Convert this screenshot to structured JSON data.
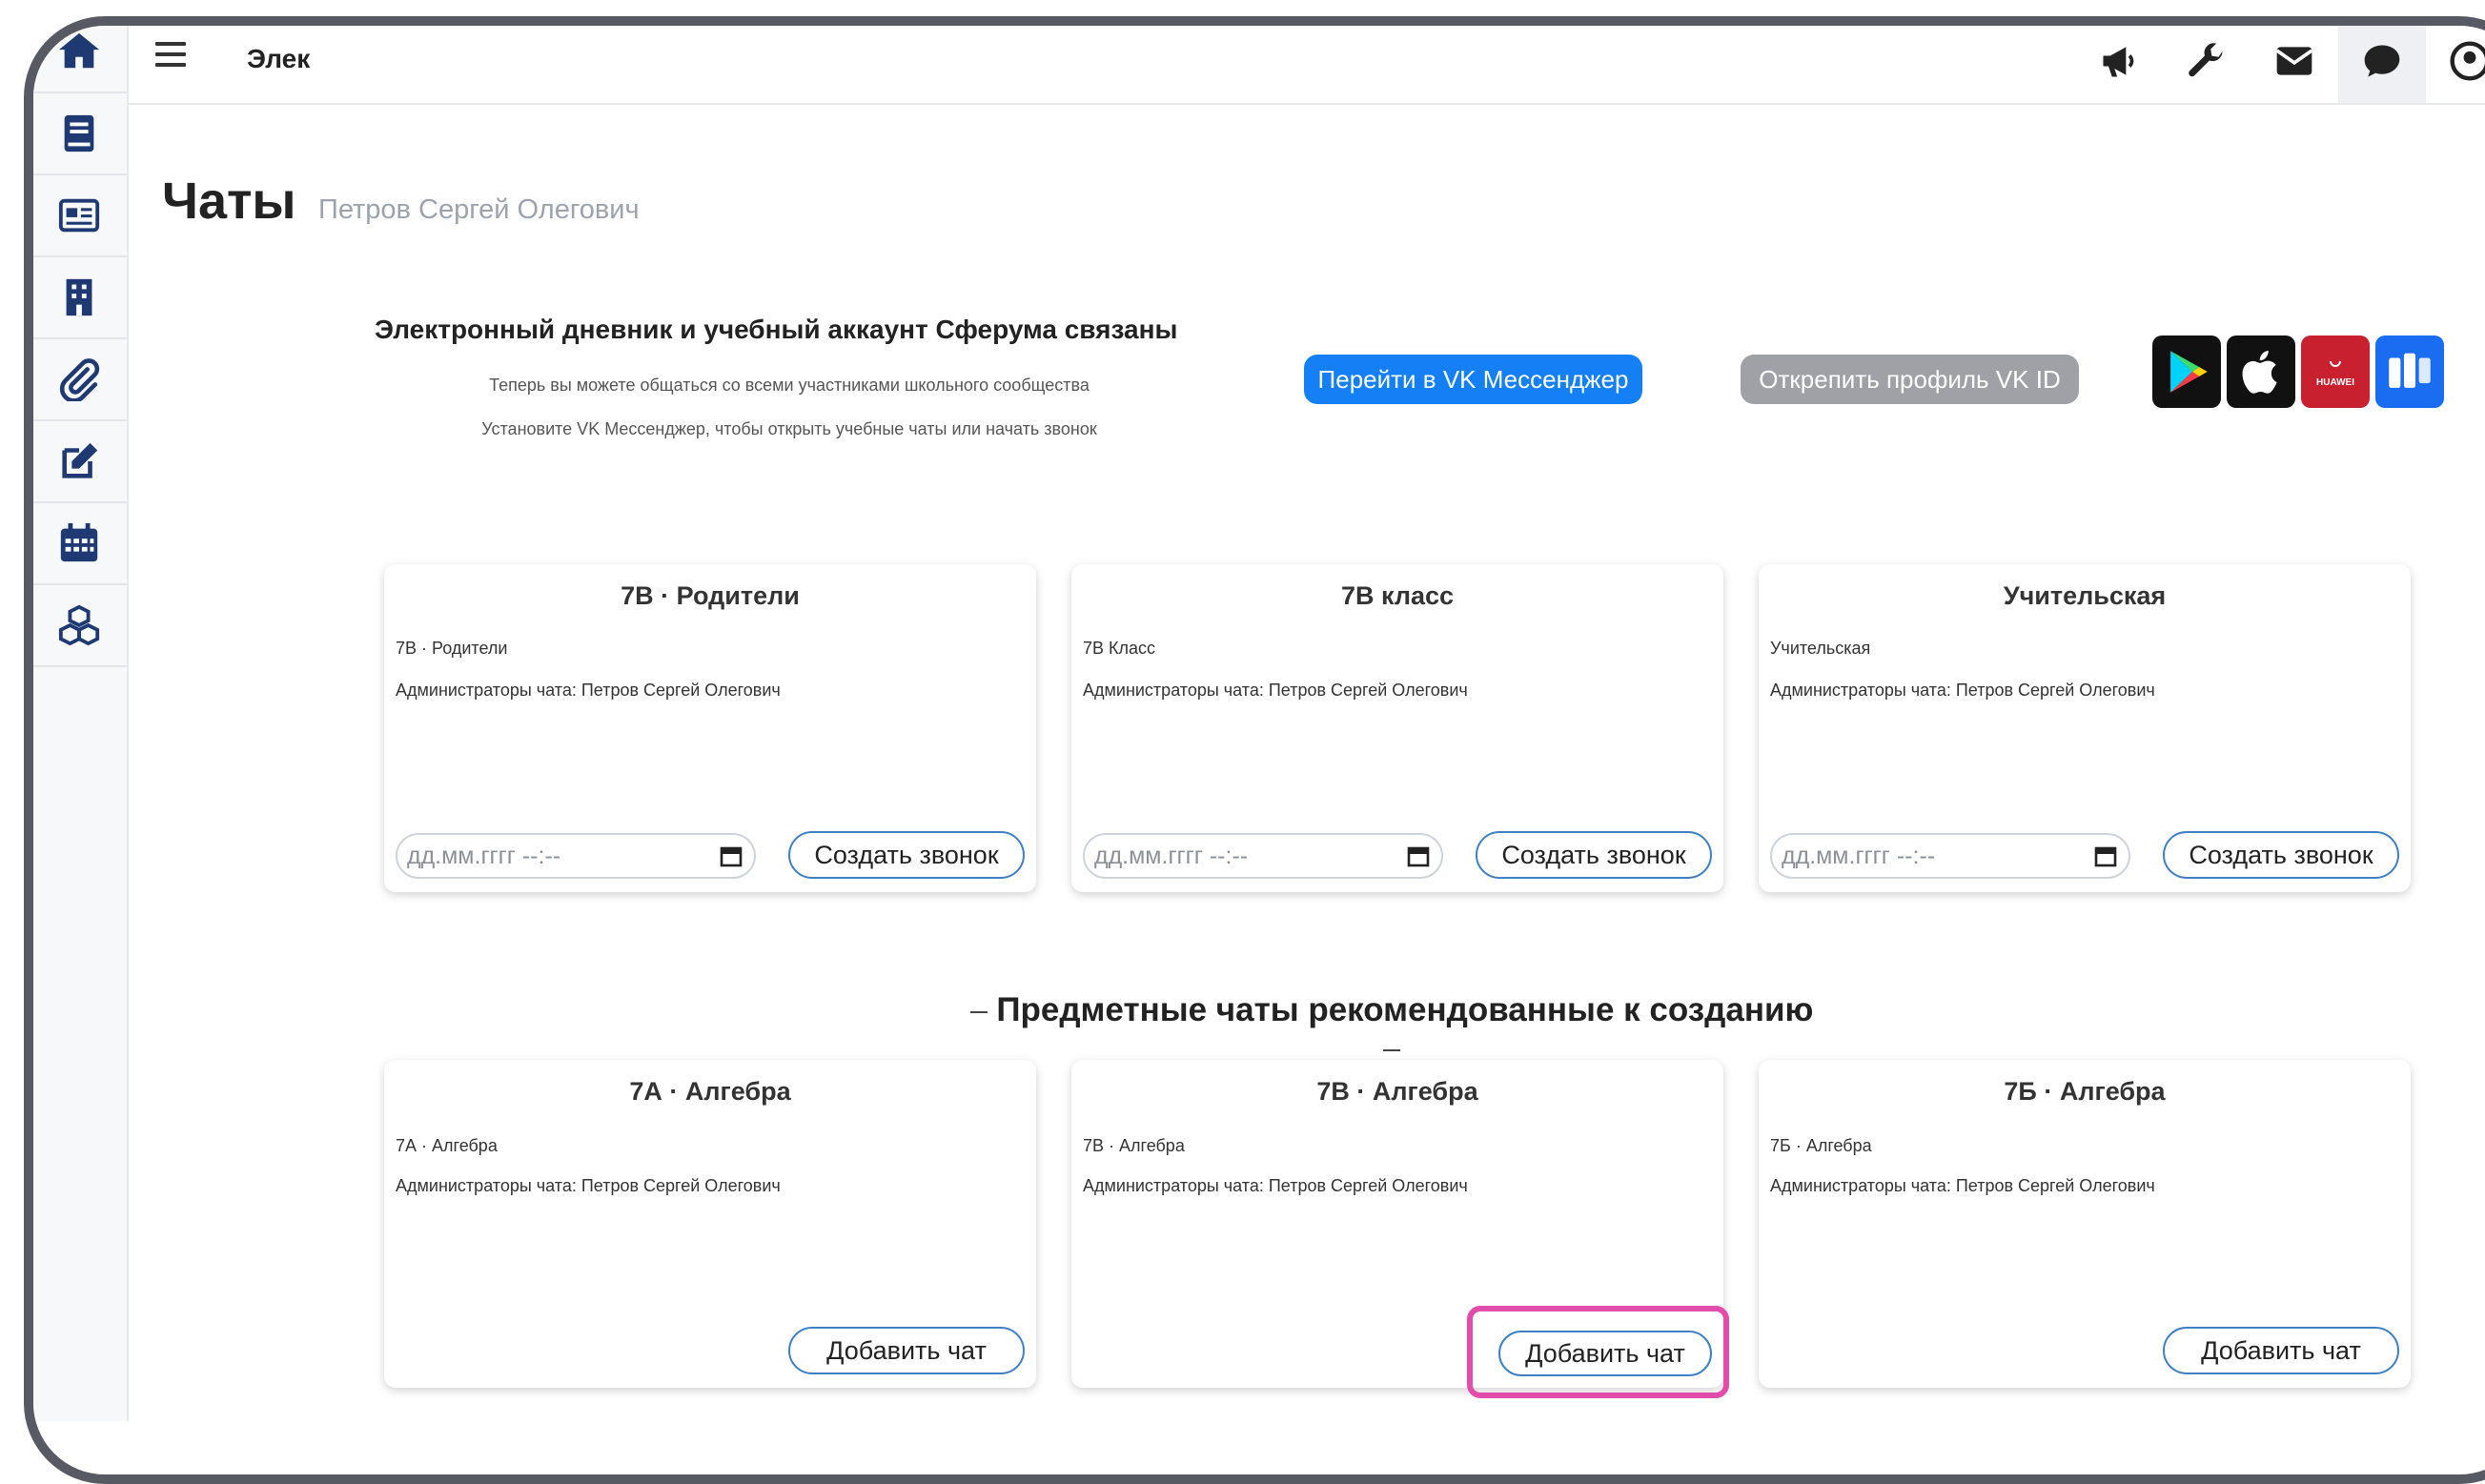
{
  "topbar": {
    "app_title": "Элек",
    "menu_icon": "hamburger-icon",
    "icons": [
      "megaphone-icon",
      "wrench-icon",
      "mail-icon",
      "chat-icon",
      "user-icon"
    ]
  },
  "sidebar": {
    "icons": [
      "home-icon",
      "book-icon",
      "newspaper-icon",
      "building-icon",
      "paperclip-icon",
      "edit-icon",
      "calendar-icon",
      "cubes-icon"
    ]
  },
  "page": {
    "title": "Чаты",
    "user": "Петров Сергей Олегович"
  },
  "banner": {
    "title": "Электронный дневник и учебный аккаунт Сферума связаны",
    "line1": "Теперь вы можете общаться со всеми участниками школьного сообщества",
    "line2": "Установите VK Мессенджер, чтобы открыть учебные чаты или начать звонок",
    "vk_button": "Перейти в VK Мессенджер",
    "unlink_button": "Открепить профиль VK ID",
    "stores": [
      "google-play-icon",
      "apple-icon",
      "huawei-icon",
      "rustore-icon"
    ],
    "huawei_label": "HUAWEI"
  },
  "existing_chats": [
    {
      "title": "7В · Родители",
      "subtitle": "7В · Родители",
      "admins": "Администраторы чата: Петров Сергей Олегович",
      "date_placeholder": "дд.мм.гггг --:--",
      "call_button": "Создать звонок"
    },
    {
      "title": "7В класс",
      "subtitle": "7В Класс",
      "admins": "Администраторы чата: Петров Сергей Олегович",
      "date_placeholder": "дд.мм.гггг --:--",
      "call_button": "Создать звонок"
    },
    {
      "title": "Учительская",
      "subtitle": "Учительская",
      "admins": "Администраторы чата: Петров Сергей Олегович",
      "date_placeholder": "дд.мм.гггг --:--",
      "call_button": "Создать звонок"
    }
  ],
  "recommended_heading": "Предметные чаты рекомендованные к созданию",
  "recommended_chats": [
    {
      "title": "7А · Алгебра",
      "subtitle": "7А · Алгебра",
      "admins": "Администраторы чата: Петров Сергей Олегович",
      "add_button": "Добавить чат"
    },
    {
      "title": "7В · Алгебра",
      "subtitle": "7В · Алгебра",
      "admins": "Администраторы чата: Петров Сергей Олегович",
      "add_button": "Добавить чат"
    },
    {
      "title": "7Б · Алгебра",
      "subtitle": "7Б · Алгебра",
      "admins": "Администраторы чата: Петров Сергей Олегович",
      "add_button": "Добавить чат"
    }
  ],
  "colors": {
    "vk_button": "#1580f5",
    "unlink_button": "#9fa1a6",
    "highlight": "#e24caa",
    "button_border": "#3f7fc3",
    "sidebar_icon": "#1f3a73"
  }
}
